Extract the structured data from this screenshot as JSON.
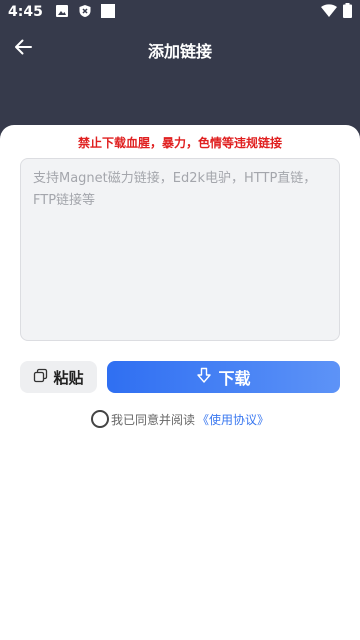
{
  "status_bar": {
    "time": "4:45",
    "left_icons": [
      "image-icon",
      "shield-icon",
      "square-icon"
    ],
    "right_icons": [
      "wifi-icon",
      "battery-icon"
    ]
  },
  "header": {
    "title": "添加链接",
    "back_icon": "arrow-left-icon"
  },
  "warning_text": "禁止下载血腥，暴力，色情等违规链接",
  "link_input": {
    "placeholder": "支持Magnet磁力链接，Ed2k电驴，HTTP直链，FTP链接等",
    "value": ""
  },
  "paste_button": {
    "label": "粘贴",
    "icon": "copy-icon"
  },
  "download_button": {
    "label": "下载",
    "icon": "download-arrow-icon"
  },
  "agreement": {
    "checked": false,
    "text": "我已同意并阅读",
    "link_text": "《使用协议》"
  },
  "colors": {
    "header_bg": "#363a4b",
    "warning": "#e02020",
    "accent": "#2f6ff2",
    "link": "#3a78f0"
  }
}
